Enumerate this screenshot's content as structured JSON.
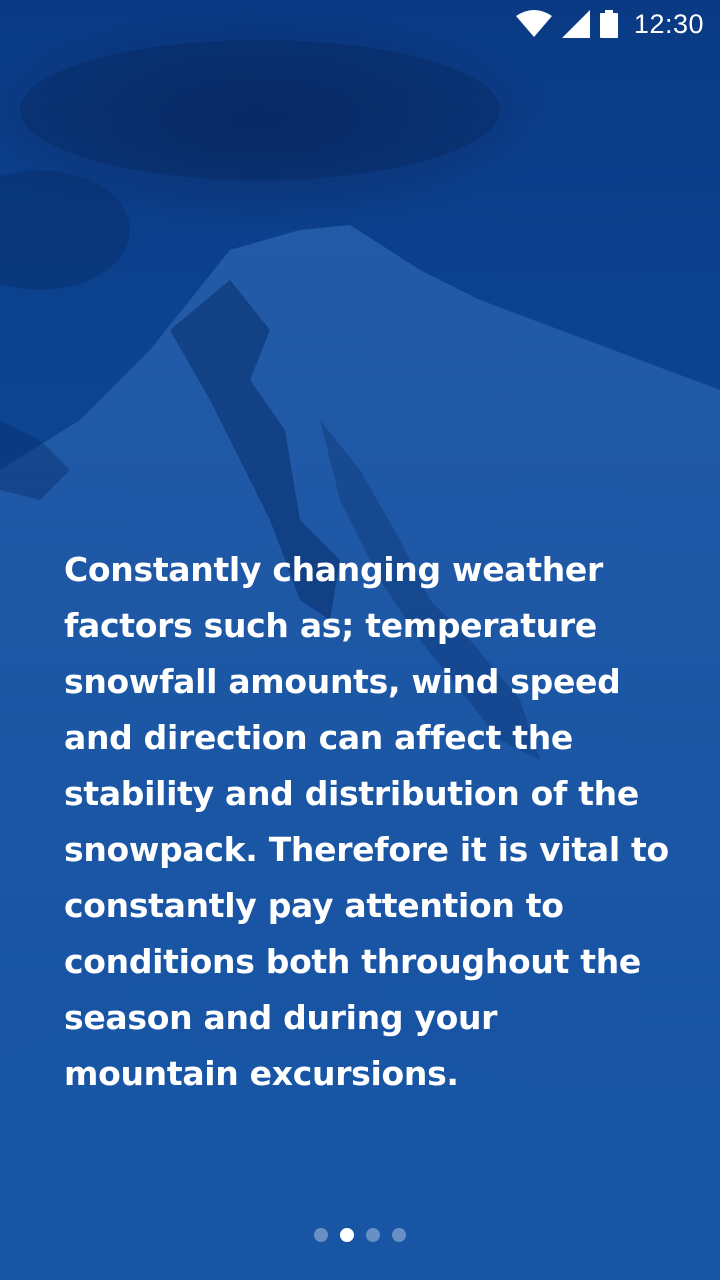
{
  "status_bar": {
    "time": "12:30",
    "icons": [
      "wifi-icon",
      "cell-signal-icon",
      "battery-icon"
    ]
  },
  "onboarding": {
    "message_lines": [
      "Constantly changing weather",
      "factors such as; temperature",
      "snowfall amounts, wind speed",
      "and direction can affect the",
      "stability and distribution of the",
      "snowpack. Therefore it is vital to",
      "constantly pay attention to",
      "conditions both throughout the",
      "season and during your",
      "mountain excursions."
    ]
  },
  "pager": {
    "count": 4,
    "active_index": 1
  },
  "colors": {
    "background": "#0d4593",
    "text": "#ffffff",
    "dot_active": "#ffffff",
    "dot_inactive": "#7f9cc8"
  }
}
